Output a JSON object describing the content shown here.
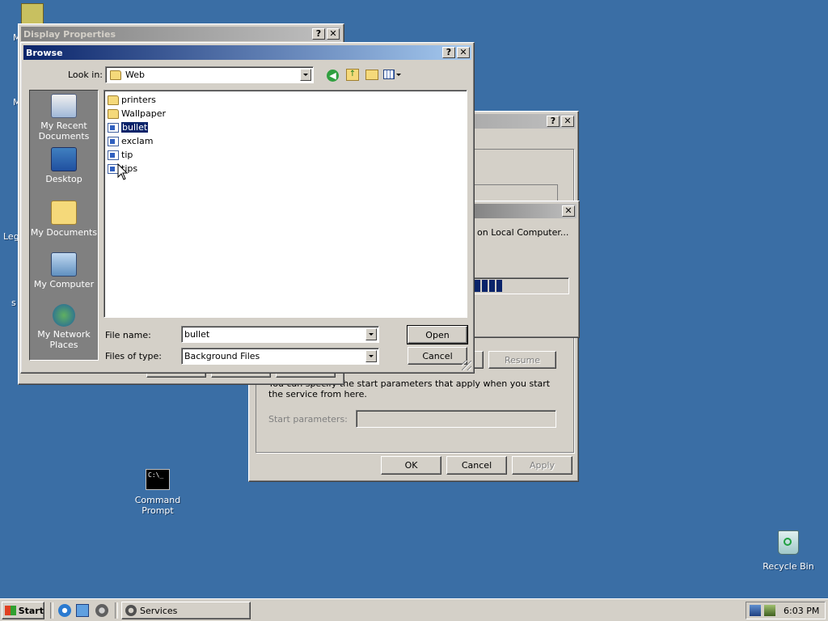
{
  "desktop": {
    "icons": [
      {
        "label": "Command Prompt",
        "icon": "command-prompt-icon"
      },
      {
        "label": "Recycle Bin",
        "icon": "recycle-bin-icon"
      }
    ],
    "partial_labels": [
      "M",
      "M",
      "Leg",
      "s"
    ]
  },
  "display_properties": {
    "title": "Display Properties",
    "help": "?",
    "close": "✕"
  },
  "service_window": {
    "help": "?",
    "close": "✕",
    "progress_text": "on Local Computer...",
    "progress_fraction": 0.3,
    "resume_label": "Resume",
    "description": "You can specify the start parameters that apply when you start the service from here.",
    "start_params_label": "Start parameters:",
    "start_params_value": "",
    "ok": "OK",
    "cancel": "Cancel",
    "apply": "Apply"
  },
  "browse": {
    "title": "Browse",
    "help": "?",
    "close": "✕",
    "look_in_label": "Look in:",
    "look_in_value": "Web",
    "places": [
      {
        "label": "My Recent Documents",
        "icon": "recent-documents-icon"
      },
      {
        "label": "Desktop",
        "icon": "desktop-icon"
      },
      {
        "label": "My Documents",
        "icon": "my-documents-icon"
      },
      {
        "label": "My Computer",
        "icon": "my-computer-icon"
      },
      {
        "label": "My Network Places",
        "icon": "network-places-icon"
      }
    ],
    "files": [
      {
        "name": "printers",
        "type": "folder"
      },
      {
        "name": "Wallpaper",
        "type": "folder"
      },
      {
        "name": "bullet",
        "type": "image",
        "selected": true
      },
      {
        "name": "exclam",
        "type": "image"
      },
      {
        "name": "tip",
        "type": "image"
      },
      {
        "name": "tips",
        "type": "image"
      }
    ],
    "file_name_label": "File name:",
    "file_name_value": "bullet",
    "files_of_type_label": "Files of type:",
    "files_of_type_value": "Background Files",
    "open": "Open",
    "cancel": "Cancel"
  },
  "taskbar": {
    "start": "Start",
    "task": "Services",
    "clock": "6:03 PM"
  },
  "colors": {
    "desktop": "#3a6ea5",
    "title_active": "#0a246a",
    "selection": "#0a246a"
  }
}
